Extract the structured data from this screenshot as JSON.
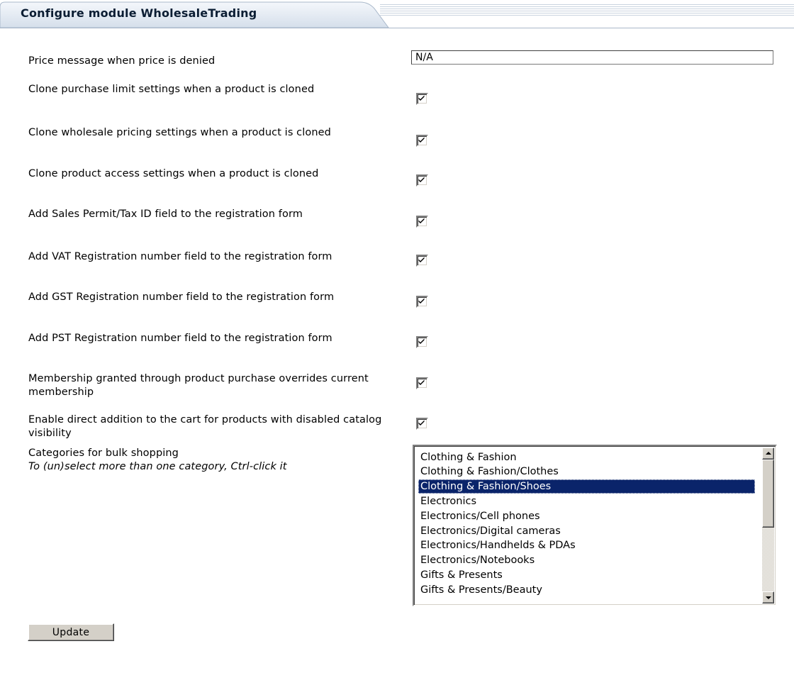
{
  "header": {
    "title": "Configure module WholesaleTrading"
  },
  "settings": [
    {
      "label": "Price message when price is denied",
      "type": "text",
      "value": "N/A"
    },
    {
      "label": "Clone purchase limit settings when a product is cloned",
      "type": "checkbox",
      "checked": true
    },
    {
      "label": "Clone wholesale pricing settings when a product is cloned",
      "type": "checkbox",
      "checked": true
    },
    {
      "label": "Clone product access settings when a product is cloned",
      "type": "checkbox",
      "checked": true
    },
    {
      "label": "Add Sales Permit/Tax ID field to the registration form",
      "type": "checkbox",
      "checked": true
    },
    {
      "label": "Add VAT Registration number field to the registration form",
      "type": "checkbox",
      "checked": true
    },
    {
      "label": "Add GST Registration number field to the registration form",
      "type": "checkbox",
      "checked": true
    },
    {
      "label": "Add PST Registration number field to the registration form",
      "type": "checkbox",
      "checked": true
    },
    {
      "label": "Membership granted through product purchase overrides current membership",
      "type": "checkbox",
      "checked": true
    },
    {
      "label": "Enable direct addition to the cart for products with disabled catalog visibility",
      "type": "checkbox",
      "checked": true
    }
  ],
  "categories": {
    "label": "Categories for bulk shopping",
    "hint": "To (un)select more than one category, Ctrl-click it",
    "options": [
      "Clothing & Fashion",
      "Clothing & Fashion/Clothes",
      "Clothing & Fashion/Shoes",
      "Electronics",
      "Electronics/Cell phones",
      "Electronics/Digital cameras",
      "Electronics/Handhelds & PDAs",
      "Electronics/Notebooks",
      "Gifts & Presents",
      "Gifts & Presents/Beauty"
    ],
    "selected": "Clothing & Fashion/Shoes"
  },
  "actions": {
    "update_label": "Update"
  },
  "colors": {
    "selection": "#0a246a",
    "tab_fill": "#dde5ef",
    "tab_border": "#9fb0c5"
  }
}
